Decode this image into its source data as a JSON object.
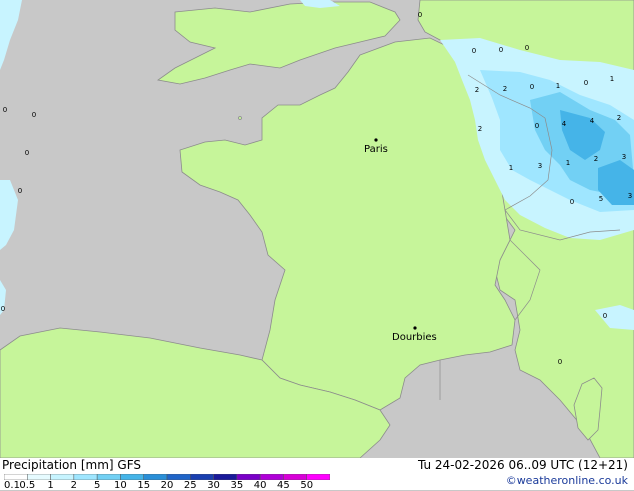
{
  "title": {
    "prefix": "Precipitation [mm]",
    "model": "GFS"
  },
  "valid": "Tu 24-02-2026 06..09 UTC (12+21)",
  "credit": "©weatheronline.co.uk",
  "cities": [
    {
      "name": "Paris"
    },
    {
      "name": "Dourbies"
    }
  ],
  "legend": {
    "labels": [
      "0.1",
      "0.5",
      "1",
      "2",
      "5",
      "10",
      "15",
      "20",
      "25",
      "30",
      "35",
      "40",
      "45",
      "50"
    ],
    "colors": [
      "#ffffff",
      "#e6fbff",
      "#c7f4ff",
      "#9fe6ff",
      "#72d0f4",
      "#45b4e8",
      "#2a8fd8",
      "#2065c8",
      "#1a3fb0",
      "#1a1a9a",
      "#7a00c8",
      "#b000d8",
      "#d800d8",
      "#ff00ff"
    ]
  },
  "values": [
    "0",
    "0",
    "0",
    "0",
    "0",
    "0",
    "0",
    "0",
    "2",
    "0",
    "1",
    "0",
    "1",
    "0",
    "4",
    "4",
    "2",
    "0",
    "1",
    "3",
    "1",
    "2",
    "3",
    "0",
    "5",
    "3",
    "0",
    "0"
  ],
  "colors": {
    "sea": "#c8c8c8",
    "land": "#c6f59a",
    "border": "#8c8c8c",
    "precip_light": "#c8f4ff",
    "precip_mid": "#72d0f4",
    "precip_heavy": "#45b4e8"
  }
}
